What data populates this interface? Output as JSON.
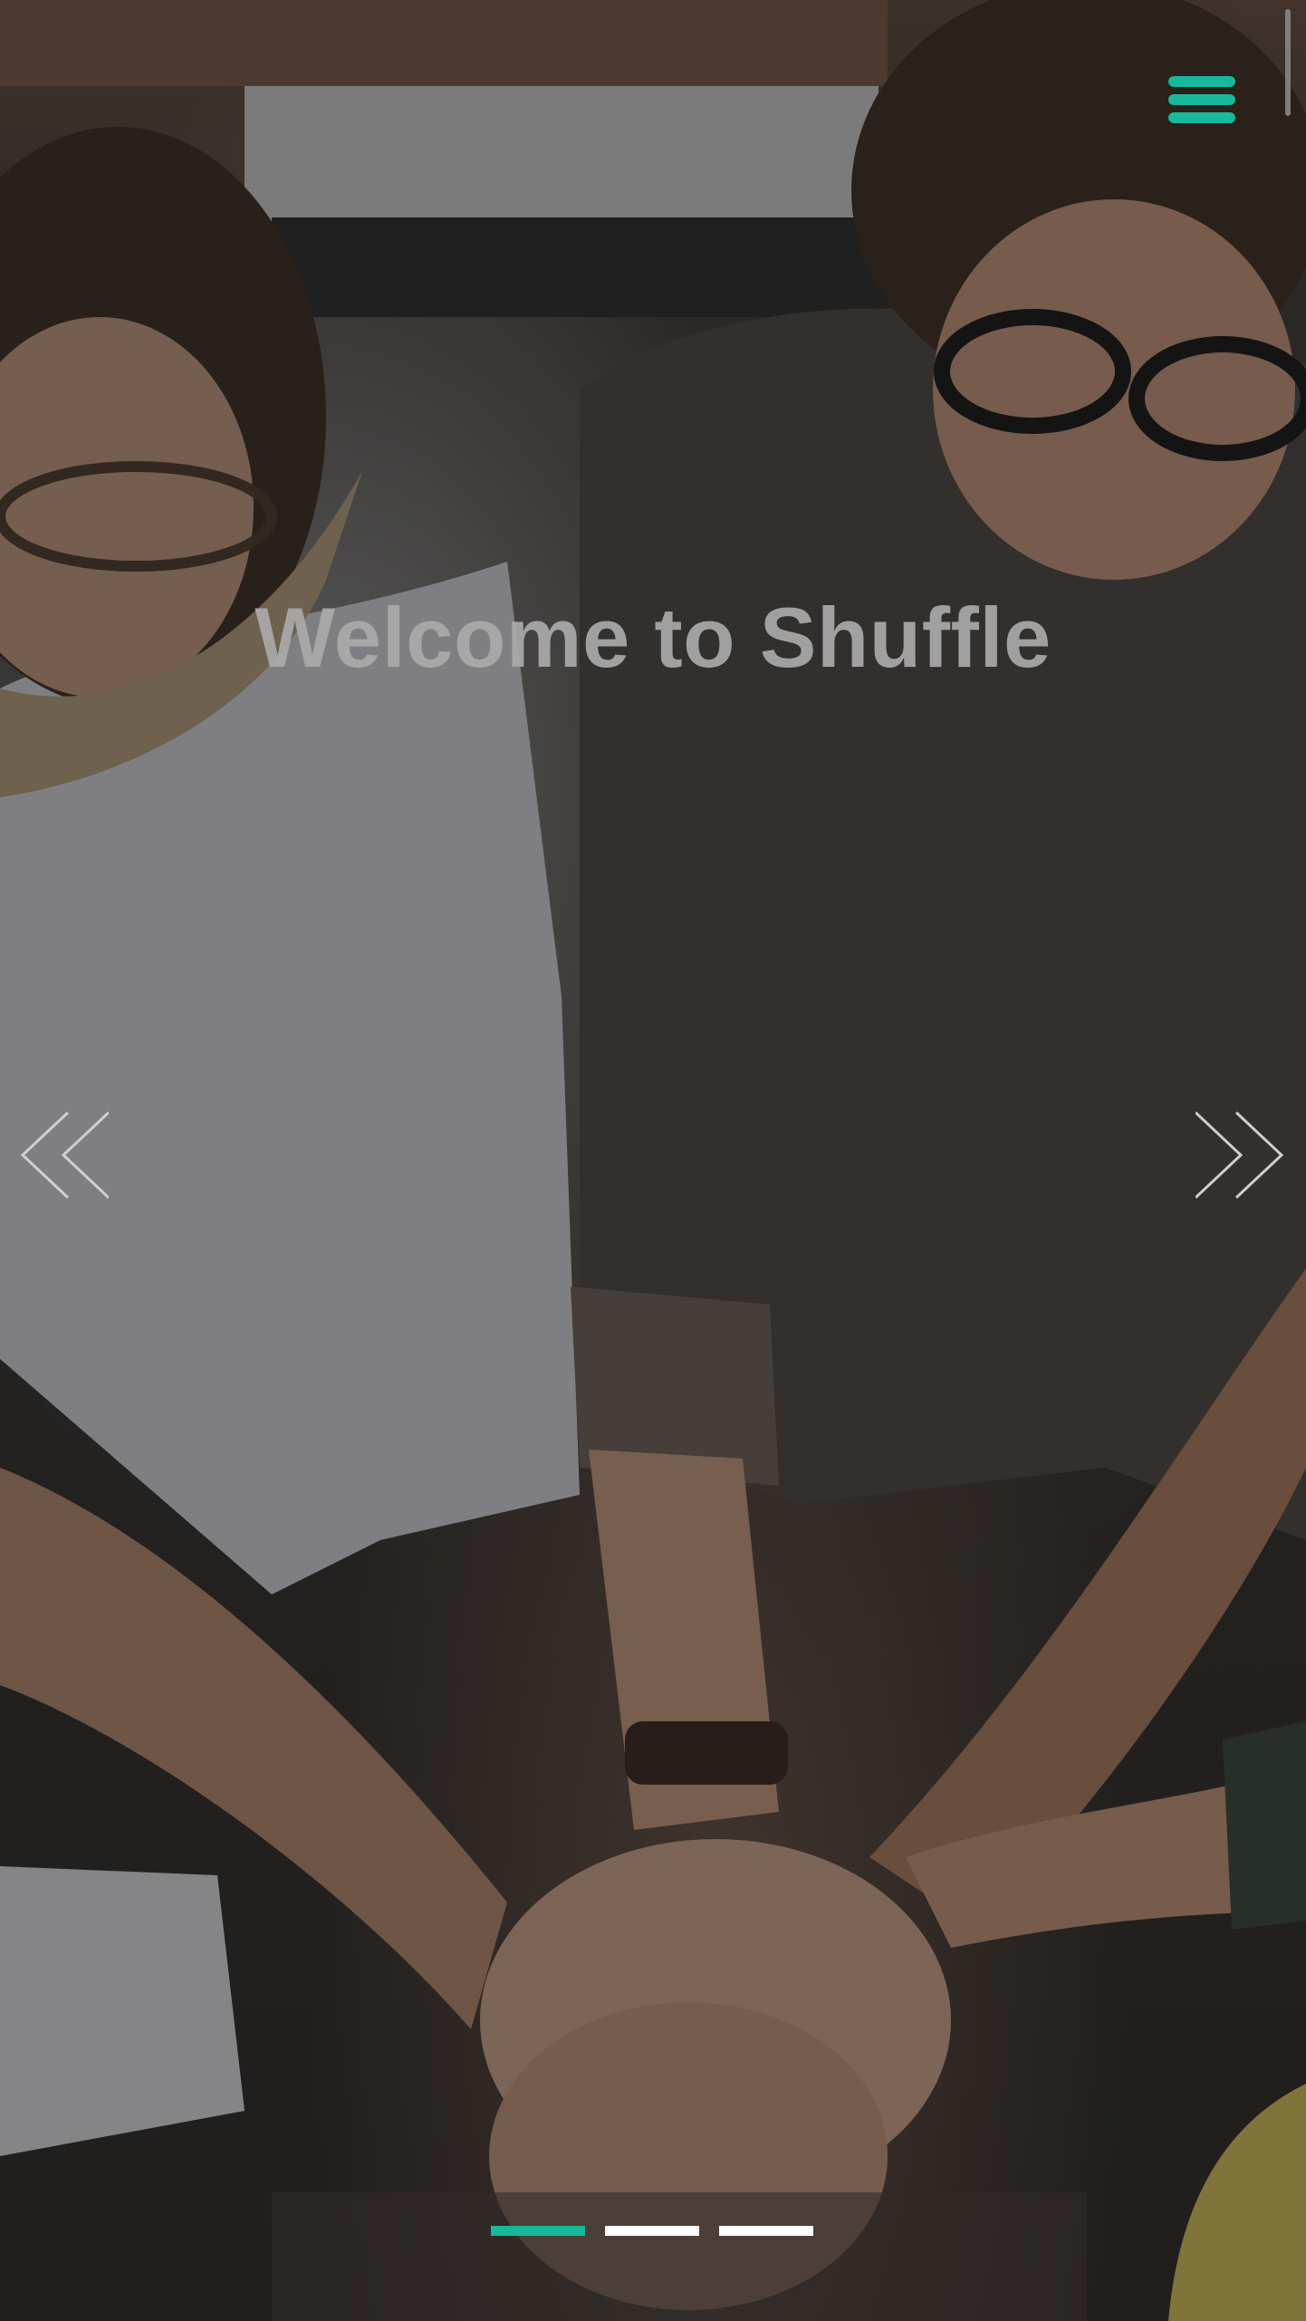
{
  "header": {
    "menu_icon": "hamburger-menu-icon",
    "accent_color": "#17b99a"
  },
  "hero": {
    "title": "Welcome to Shuffle",
    "prev_icon": "double-chevron-left-icon",
    "next_icon": "double-chevron-right-icon"
  },
  "carousel": {
    "slides": [
      {
        "active": true
      },
      {
        "active": false
      },
      {
        "active": false
      }
    ],
    "active_color": "#17b99a",
    "inactive_color": "#ffffff"
  }
}
